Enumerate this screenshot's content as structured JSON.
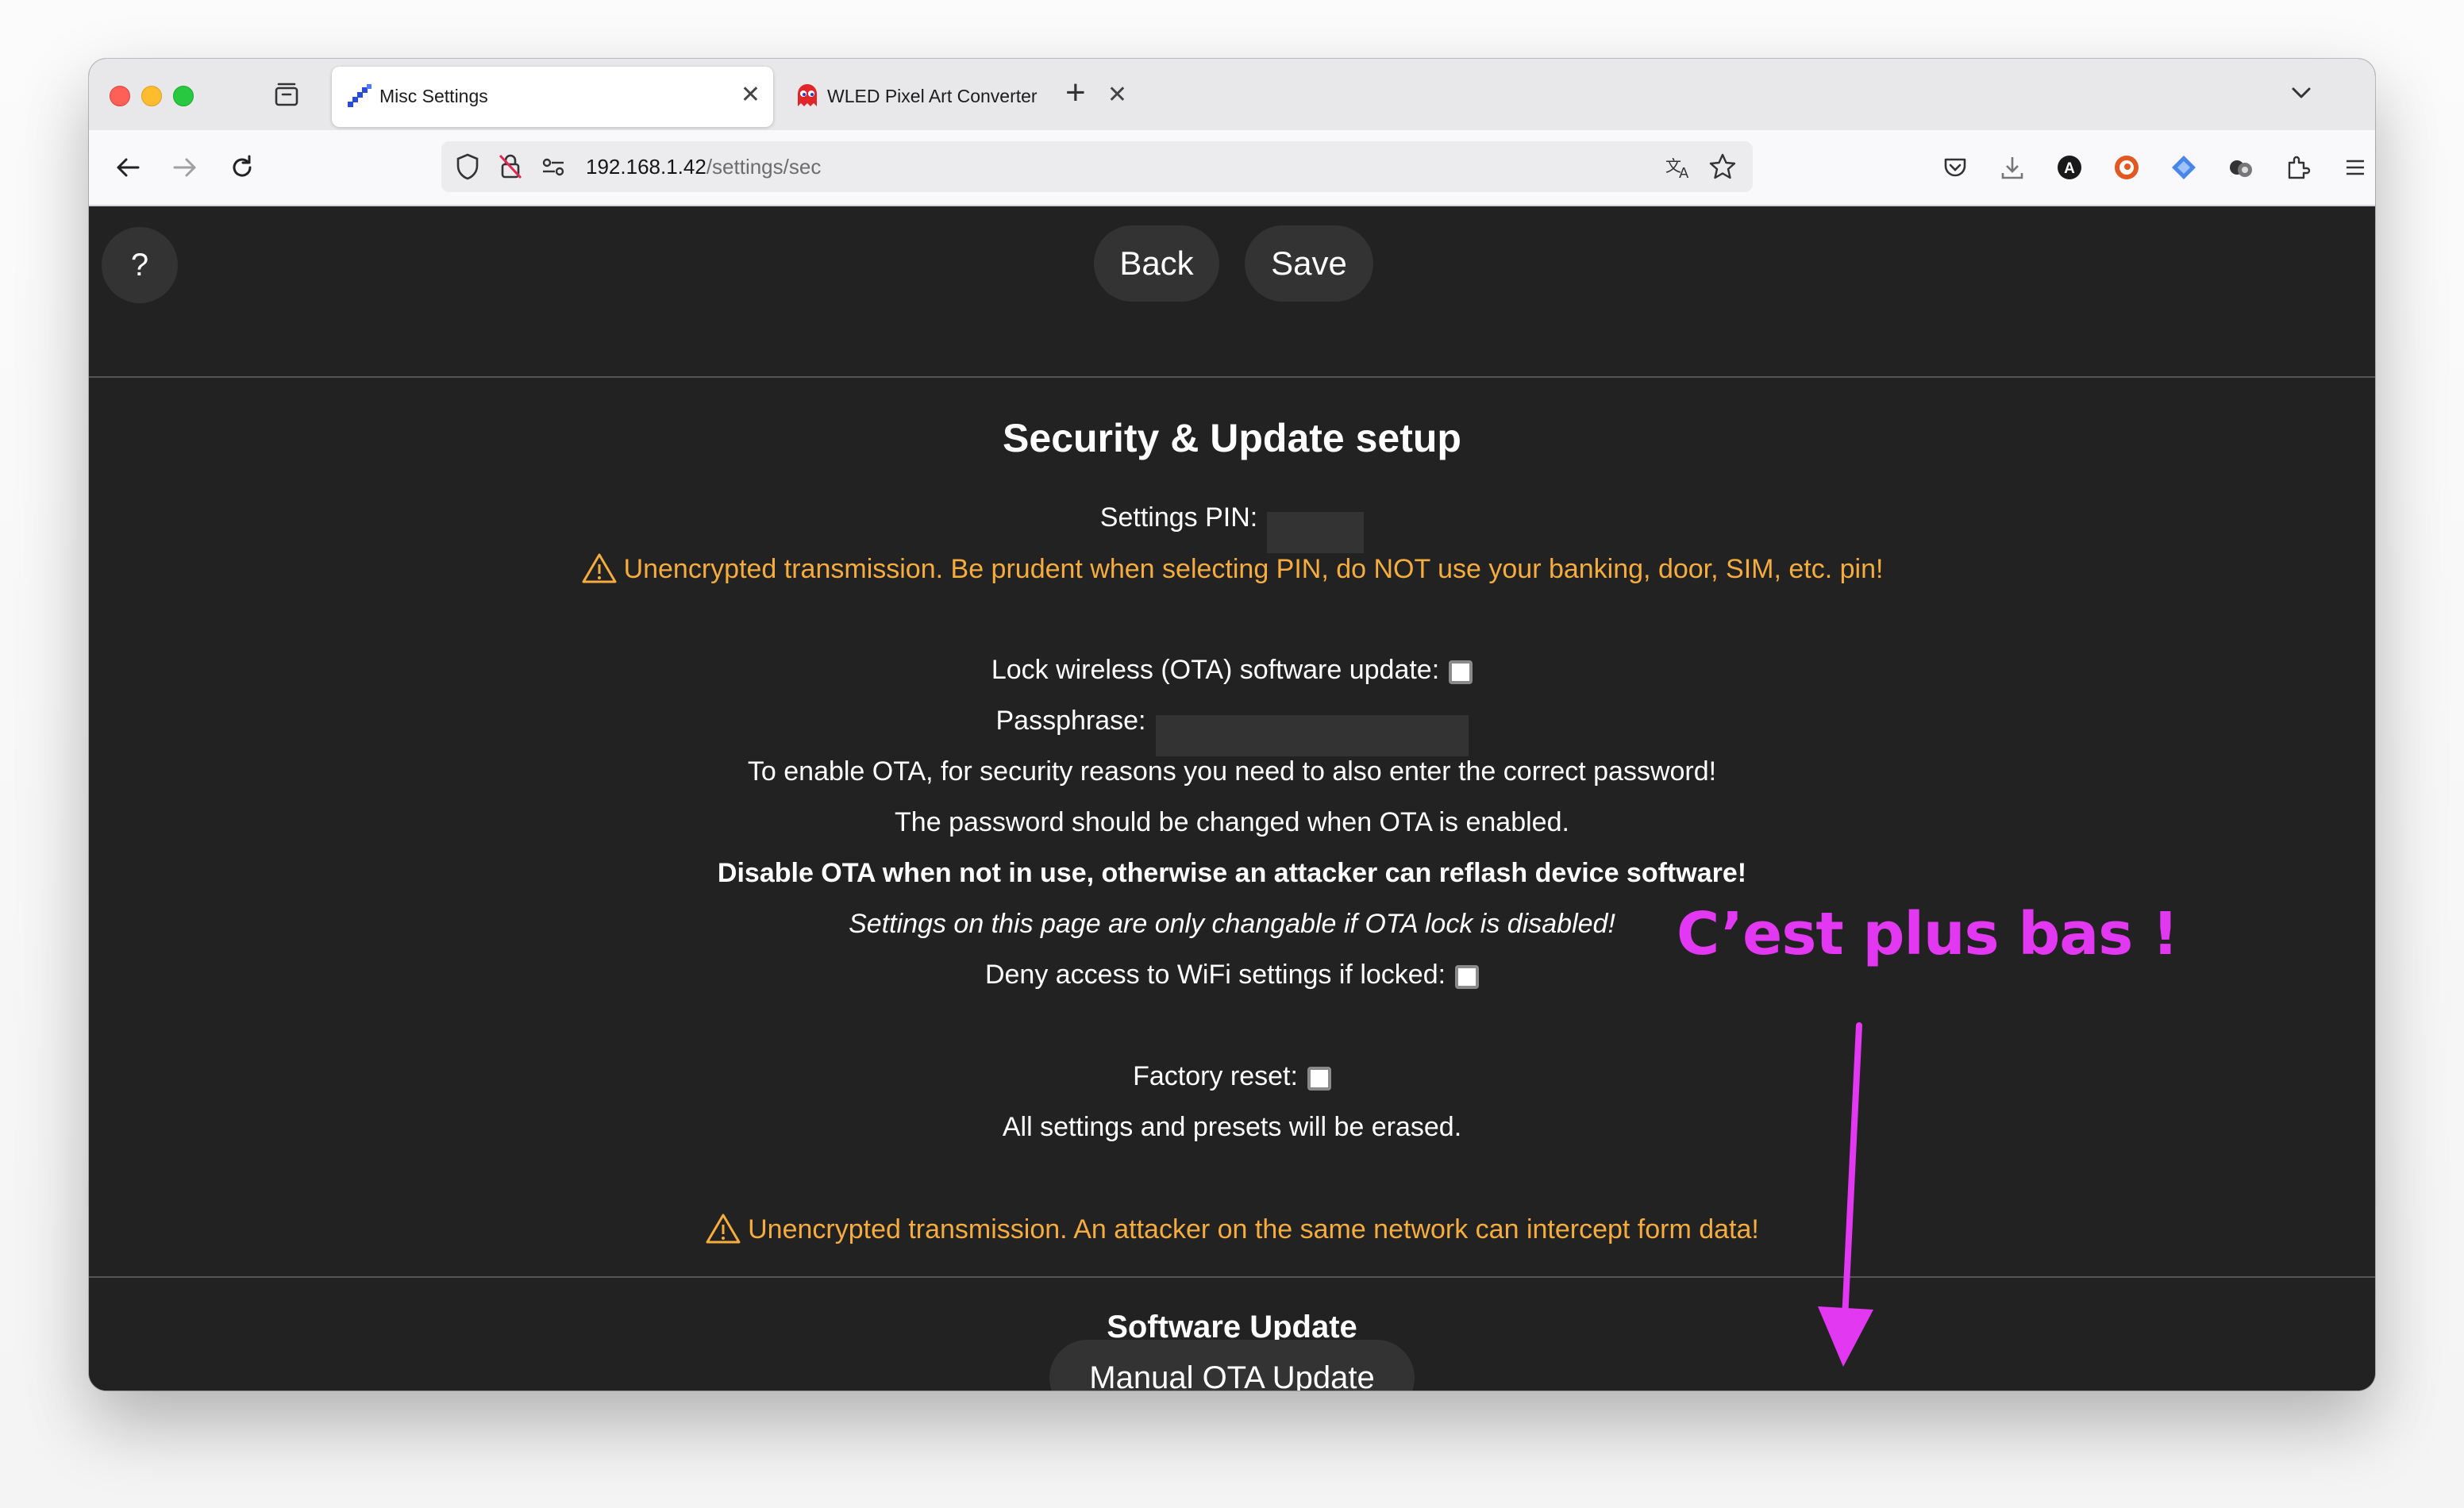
{
  "browser": {
    "tabs": [
      {
        "title": "Misc Settings",
        "active": true
      },
      {
        "title": "WLED Pixel Art Converter",
        "active": false
      }
    ],
    "url": {
      "host": "192.168.1.42",
      "path": "/settings/sec"
    }
  },
  "page": {
    "help_label": "?",
    "back_label": "Back",
    "save_label": "Save",
    "title": "Security & Update setup",
    "pin_label": "Settings PIN:",
    "pin_warning": "Unencrypted transmission. Be prudent when selecting PIN, do NOT use your banking, door, SIM, etc. pin!",
    "ota_lock_label": "Lock wireless (OTA) software update:",
    "passphrase_label": "Passphrase:",
    "ota_info_1": "To enable OTA, for security reasons you need to also enter the correct password!",
    "ota_info_2": "The password should be changed when OTA is enabled.",
    "ota_info_bold": "Disable OTA when not in use, otherwise an attacker can reflash device software!",
    "ota_info_italic": "Settings on this page are only changable if OTA lock is disabled!",
    "deny_wifi_label": "Deny access to WiFi settings if locked:",
    "factory_reset_label": "Factory reset:",
    "factory_reset_info": "All settings and presets will be erased.",
    "form_warning": "Unencrypted transmission. An attacker on the same network can intercept form data!",
    "software_update_title": "Software Update",
    "manual_ota_label": "Manual OTA Update"
  },
  "annotation": {
    "text": "C’est plus bas !",
    "color": "#e338f2"
  },
  "colors": {
    "page_bg": "#222222",
    "button_bg": "#333333",
    "warning": "#f6ac3e"
  }
}
